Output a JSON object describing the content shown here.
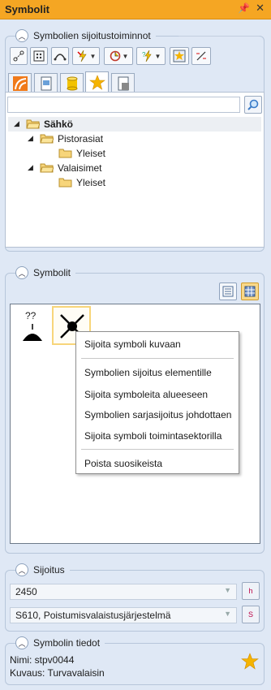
{
  "window": {
    "title": "Symbolit"
  },
  "placement_functions": {
    "header": "Symbolien sijoitustoiminnot",
    "toolbar_icons": [
      "connect-icon",
      "grid-icon",
      "arc-icon",
      "lightning-icon",
      "circle-target-icon",
      "bolt-question-icon",
      "star-symbol-icon",
      "pen-slash-icon"
    ]
  },
  "tabs": [
    "curve-tab-icon",
    "document-tab-icon",
    "cylinder-tab-icon",
    "star-tab-icon",
    "document-grid-tab-icon"
  ],
  "search": {
    "value": "",
    "placeholder": ""
  },
  "tree": {
    "root": "Sähkö",
    "children": [
      {
        "label": "Pistorasiat",
        "child": "Yleiset"
      },
      {
        "label": "Valaisimet",
        "child": "Yleiset"
      }
    ]
  },
  "symbols": {
    "header": "Symbolit",
    "question_marks": "??",
    "context_menu": [
      "Sijoita symboli kuvaan",
      "Symbolien sijoitus elementille",
      "Sijoita symboleita alueeseen",
      "Symbolien sarjasijoitus johdottaen",
      "Sijoita symboli toimintasektorilla",
      "Poista suosikeista"
    ]
  },
  "placement": {
    "header": "Sijoitus",
    "height_value": "2450",
    "height_btn": "h",
    "system_value": "S610, Poistumisvalaistusjärjestelmä",
    "system_btn": "S"
  },
  "symbol_info": {
    "header": "Symbolin tiedot",
    "name_label": "Nimi:",
    "name_value": "stpv0044",
    "desc_label": "Kuvaus:",
    "desc_value": "Turvavalaisin"
  },
  "colors": {
    "titlebar": "#f5a623",
    "panel": "#dfe8f5",
    "selection": "#f7d57a",
    "star": "#f5b400"
  }
}
